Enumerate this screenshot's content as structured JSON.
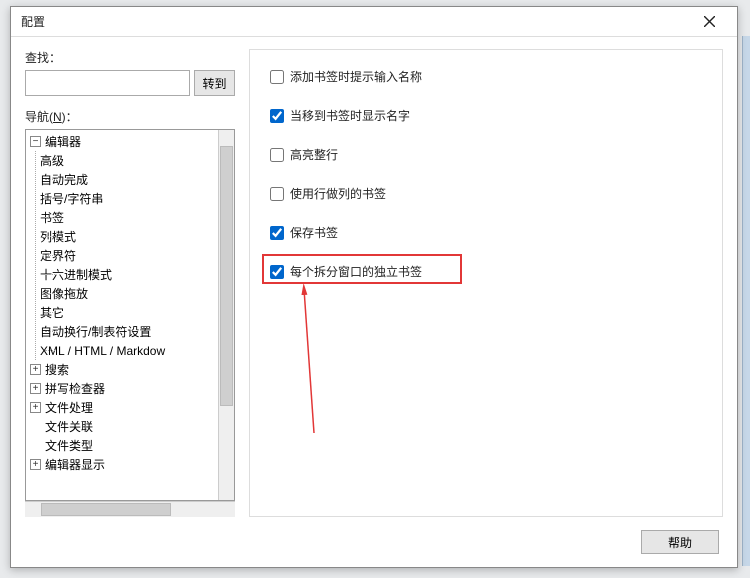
{
  "window": {
    "title": "配置"
  },
  "search": {
    "label": "查找：",
    "value": "",
    "go": "转到"
  },
  "nav": {
    "label_prefix": "导航(",
    "label_key": "N",
    "label_suffix": ")："
  },
  "tree": {
    "root": {
      "label": "编辑器",
      "children": [
        "高级",
        "自动完成",
        "括号/字符串",
        "书签",
        "列模式",
        "定界符",
        "十六进制模式",
        "图像拖放",
        "其它",
        "自动换行/制表符设置",
        "XML / HTML / Markdow"
      ]
    },
    "siblings": [
      {
        "label": "搜索",
        "exp": true
      },
      {
        "label": "拼写检查器",
        "exp": true
      },
      {
        "label": "文件处理",
        "exp": true
      },
      {
        "label": "文件关联",
        "exp": false
      },
      {
        "label": "文件类型",
        "exp": false
      },
      {
        "label": "编辑器显示",
        "exp": true
      }
    ]
  },
  "options": [
    {
      "label": "添加书签时提示输入名称",
      "checked": false
    },
    {
      "label": "当移到书签时显示名字",
      "checked": true
    },
    {
      "label": "高亮整行",
      "checked": false
    },
    {
      "label": "使用行做列的书签",
      "checked": false
    },
    {
      "label": "保存书签",
      "checked": true
    },
    {
      "label": "每个拆分窗口的独立书签",
      "checked": true
    }
  ],
  "buttons": {
    "help": "帮助"
  }
}
